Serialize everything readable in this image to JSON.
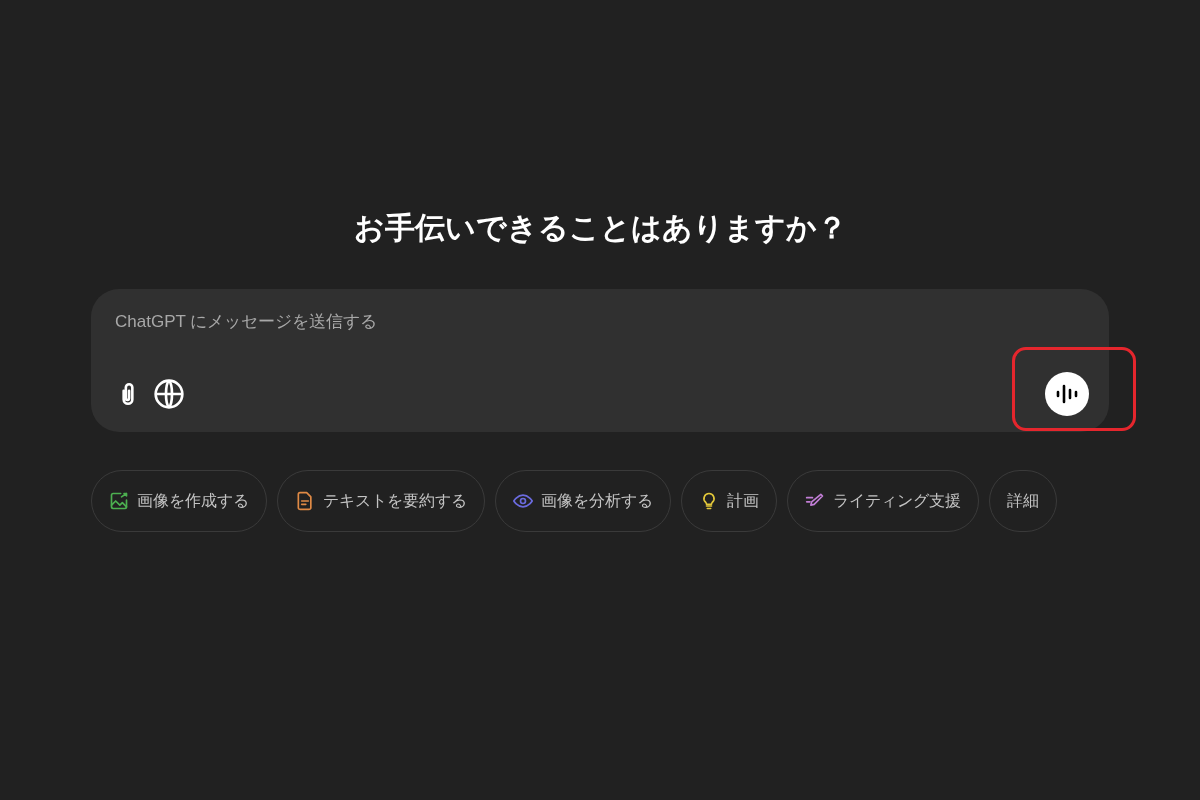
{
  "heading": "お手伝いできることはありますか？",
  "composer": {
    "placeholder": "ChatGPT にメッセージを送信する",
    "voice_highlighted": true
  },
  "chips": [
    {
      "label": "画像を作成する",
      "kind": "image",
      "color": "#4caf50"
    },
    {
      "label": "テキストを要約する",
      "kind": "document",
      "color": "#e08a45"
    },
    {
      "label": "画像を分析する",
      "kind": "eye",
      "color": "#6b6bdf"
    },
    {
      "label": "計画",
      "kind": "bulb",
      "color": "#e3c83a"
    },
    {
      "label": "ライティング支援",
      "kind": "pen",
      "color": "#c27ed6"
    },
    {
      "label": "詳細"
    }
  ]
}
